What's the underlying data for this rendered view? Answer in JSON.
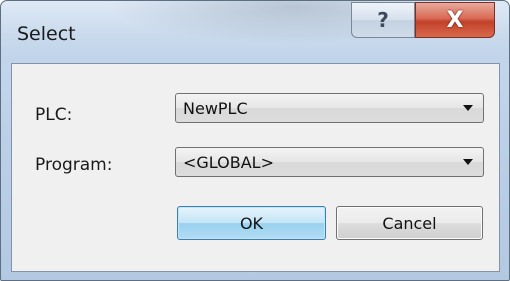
{
  "window": {
    "title": "Select",
    "help_glyph": "?",
    "close_glyph": "X"
  },
  "form": {
    "plc_label": "PLC:",
    "plc_value": "NewPLC",
    "program_label": "Program:",
    "program_value": "<GLOBAL>"
  },
  "buttons": {
    "ok_label": "OK",
    "cancel_label": "Cancel"
  },
  "icons": {
    "help": "question-mark-icon",
    "close": "close-icon",
    "dropdown": "chevron-down-icon"
  }
}
